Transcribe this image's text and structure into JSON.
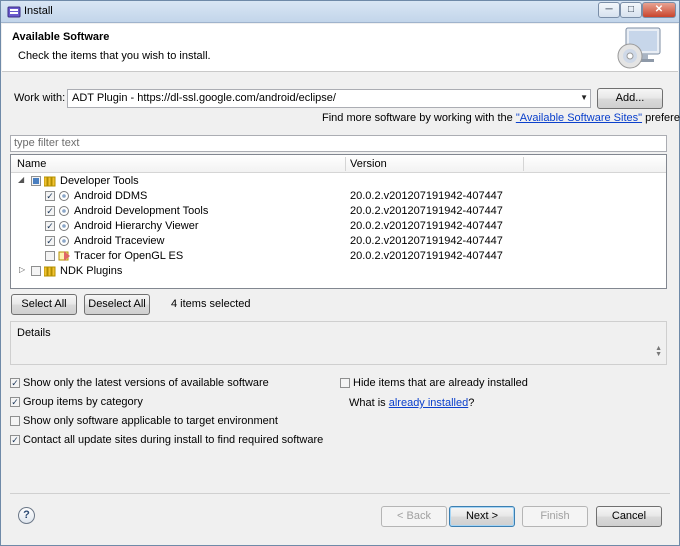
{
  "window": {
    "title": "Install",
    "minimize_glyph": "─",
    "maximize_glyph": "□",
    "close_glyph": "✕"
  },
  "header": {
    "title": "Available Software",
    "description": "Check the items that you wish to install."
  },
  "work_with": {
    "label": "Work with:",
    "value": "ADT Plugin - https://dl-ssl.google.com/android/eclipse/",
    "add_button": "Add..."
  },
  "find_more": {
    "prefix": "Find more software by working with the ",
    "link": "\"Available Software Sites\"",
    "suffix": " preferences."
  },
  "filter": {
    "placeholder": "type filter text"
  },
  "tree": {
    "columns": [
      "Name",
      "Version"
    ],
    "groups": [
      {
        "name": "Developer Tools",
        "expanded": true,
        "checked": "partial",
        "items": [
          {
            "name": "Android DDMS",
            "version": "20.0.2.v201207191942-407447",
            "checked": true
          },
          {
            "name": "Android Development Tools",
            "version": "20.0.2.v201207191942-407447",
            "checked": true
          },
          {
            "name": "Android Hierarchy Viewer",
            "version": "20.0.2.v201207191942-407447",
            "checked": true
          },
          {
            "name": "Android Traceview",
            "version": "20.0.2.v201207191942-407447",
            "checked": true
          },
          {
            "name": "Tracer for OpenGL ES",
            "version": "20.0.2.v201207191942-407447",
            "checked": false
          }
        ]
      },
      {
        "name": "NDK Plugins",
        "expanded": false,
        "checked": false,
        "items": []
      }
    ]
  },
  "selection": {
    "select_all": "Select All",
    "deselect_all": "Deselect All",
    "status": "4 items selected"
  },
  "details": {
    "label": "Details"
  },
  "options": {
    "latest_versions": {
      "label": "Show only the latest versions of available software",
      "checked": true
    },
    "group_by_category": {
      "label": "Group items by category",
      "checked": true
    },
    "target_env": {
      "label": "Show only software applicable to target environment",
      "checked": false
    },
    "contact_sites": {
      "label": "Contact all update sites during install to find required software",
      "checked": true
    },
    "hide_installed": {
      "label": "Hide items that are already installed",
      "checked": false
    },
    "what_is": {
      "prefix": "What is ",
      "link": "already installed",
      "suffix": "?"
    }
  },
  "footer": {
    "help_glyph": "?",
    "back": "< Back",
    "next": "Next >",
    "finish": "Finish",
    "cancel": "Cancel"
  },
  "colors": {
    "link": "#0b40cc",
    "checkbox_mark": "#1e395b",
    "title_bar": "#c2d5ea"
  }
}
